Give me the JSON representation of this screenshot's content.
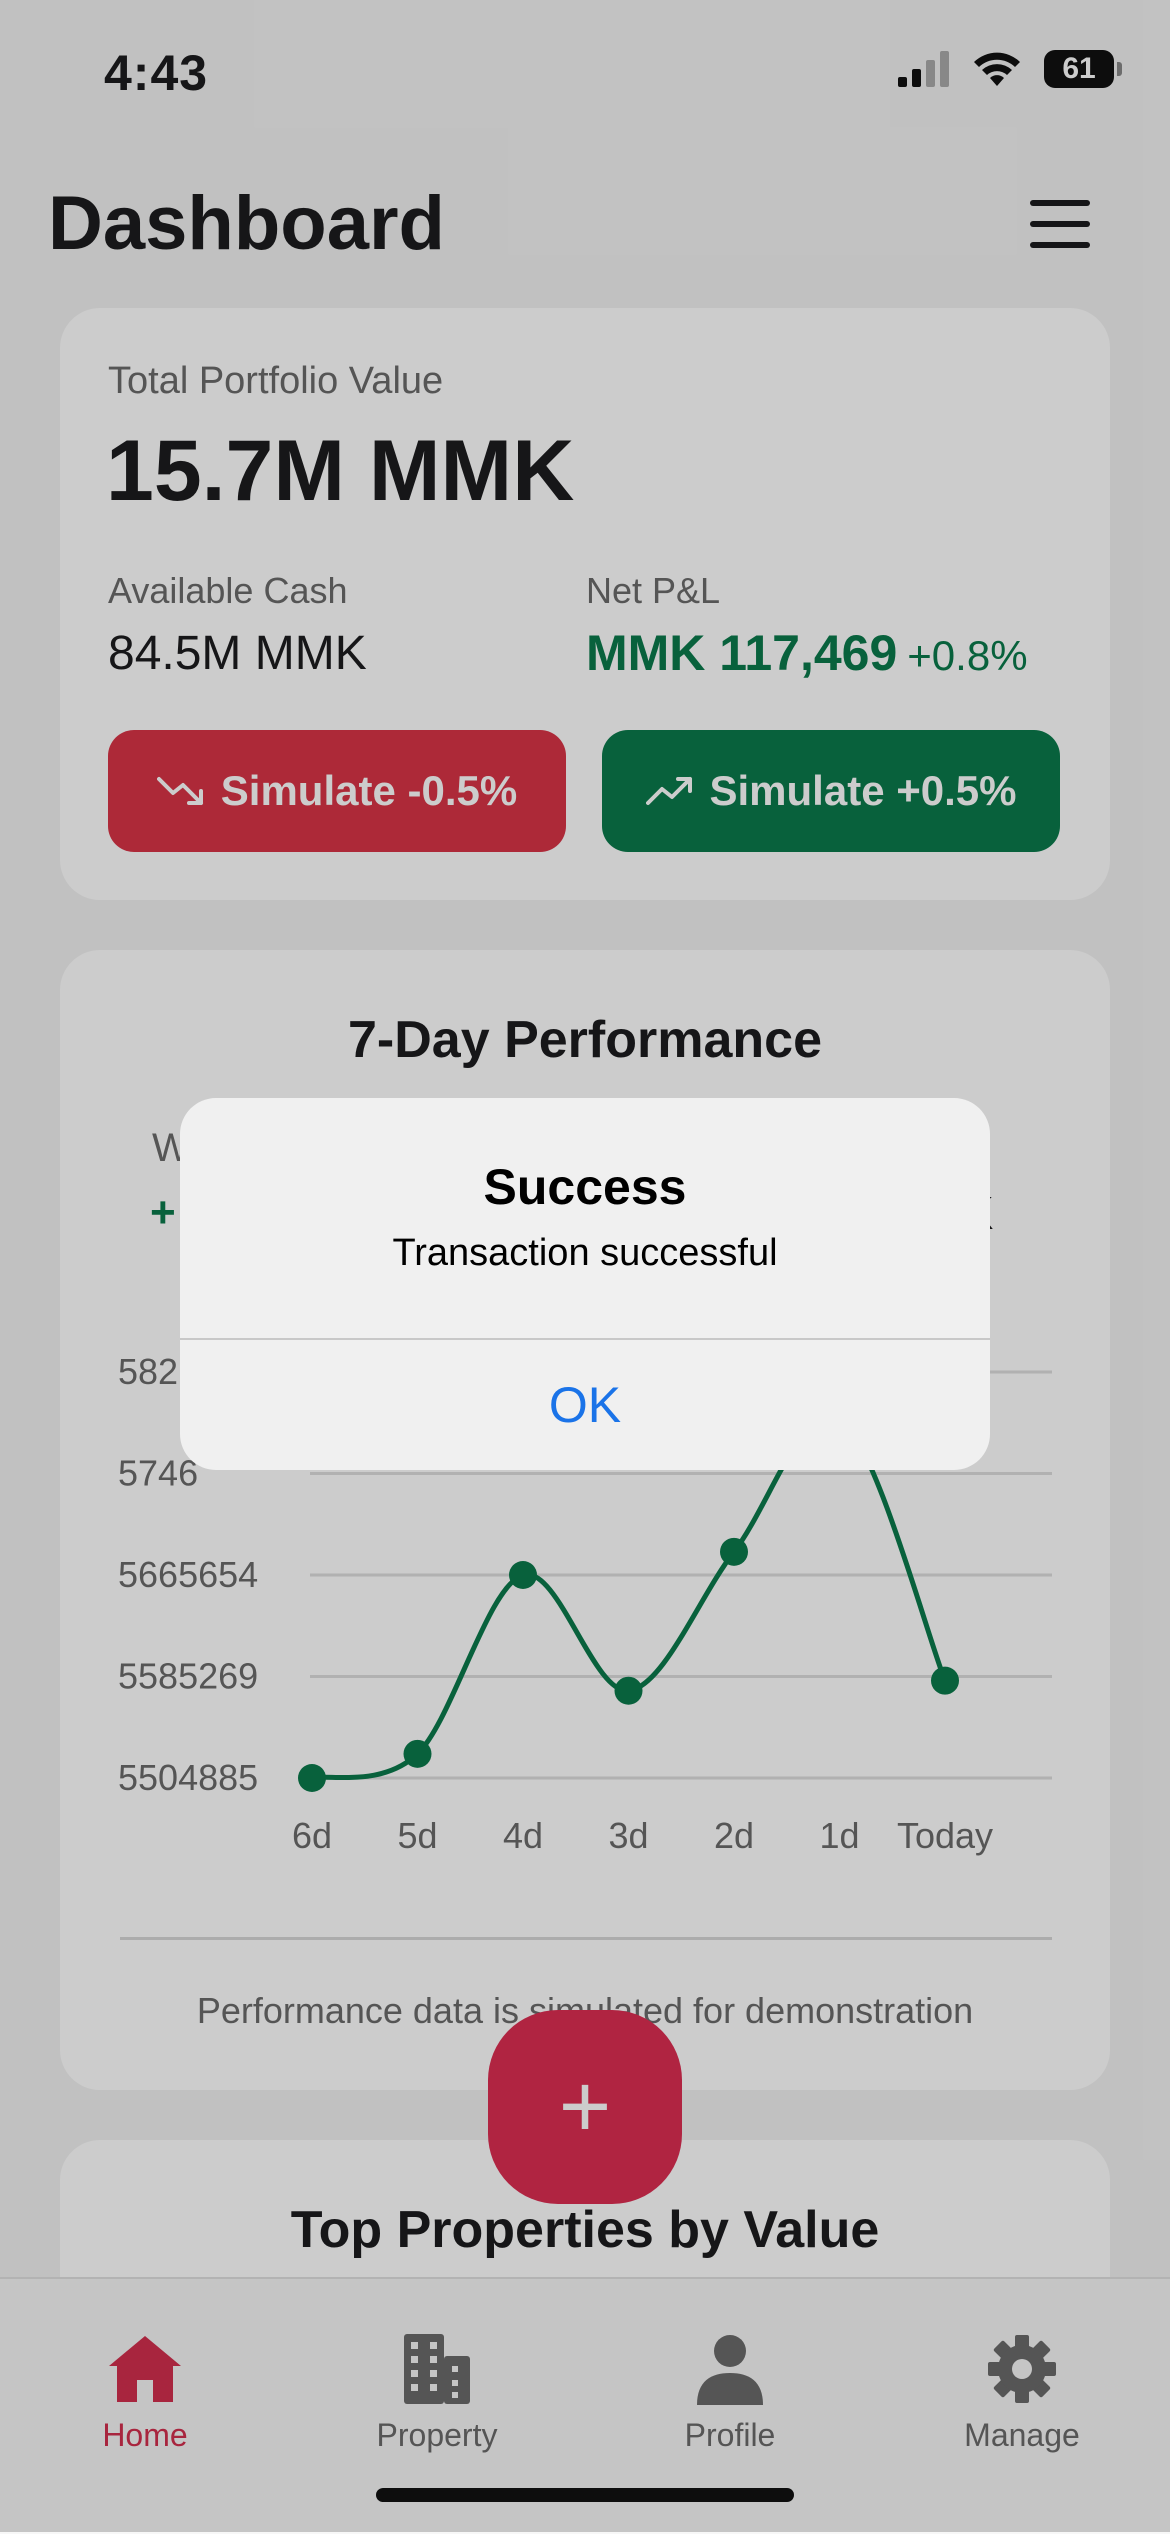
{
  "status_bar": {
    "time": "4:43",
    "battery": "61"
  },
  "header": {
    "title": "Dashboard",
    "menu_icon": "hamburger-menu-icon"
  },
  "portfolio": {
    "total_label": "Total Portfolio Value",
    "total_value": "15.7M MMK",
    "cash_label": "Available Cash",
    "cash_value": "84.5M MMK",
    "pnl_label": "Net P&L",
    "pnl_value": "MMK 117,469",
    "pnl_pct": "+0.8%",
    "simulate_down_label": "Simulate -0.5%",
    "simulate_up_label": "Simulate +0.5%"
  },
  "performance": {
    "title": "7-Day Performance",
    "partial_label": "W",
    "partial_value": "+",
    "partial_side_value": "K",
    "footnote": "Performance data is simulated for demonstration"
  },
  "chart_data": {
    "type": "line",
    "categories": [
      "6d",
      "5d",
      "4d",
      "3d",
      "2d",
      "1d",
      "Today"
    ],
    "y_ticks": [
      "582",
      "5746",
      "5665654",
      "5585269",
      "5504885"
    ],
    "y_tick_values": [
      5826423,
      5746038,
      5665654,
      5585269,
      5504885
    ],
    "values": [
      5504885,
      5524000,
      5665654,
      5574000,
      5684000,
      5790000,
      5582000
    ],
    "ylim": [
      5504885,
      5826423
    ],
    "grid": true,
    "color": "#0b7a4b"
  },
  "top_properties": {
    "title": "Top Properties by Value"
  },
  "fab": {
    "label": "+"
  },
  "tabs": [
    {
      "label": "Home",
      "icon": "home-icon",
      "active": true
    },
    {
      "label": "Property",
      "icon": "building-icon",
      "active": false
    },
    {
      "label": "Profile",
      "icon": "person-icon",
      "active": false
    },
    {
      "label": "Manage",
      "icon": "gear-icon",
      "active": false
    }
  ],
  "alert": {
    "title": "Success",
    "message": "Transaction successful",
    "ok_label": "OK"
  },
  "colors": {
    "accent": "#d32f4e",
    "positive": "#0b7a4b",
    "negative": "#d93446",
    "link": "#1a73e8"
  }
}
